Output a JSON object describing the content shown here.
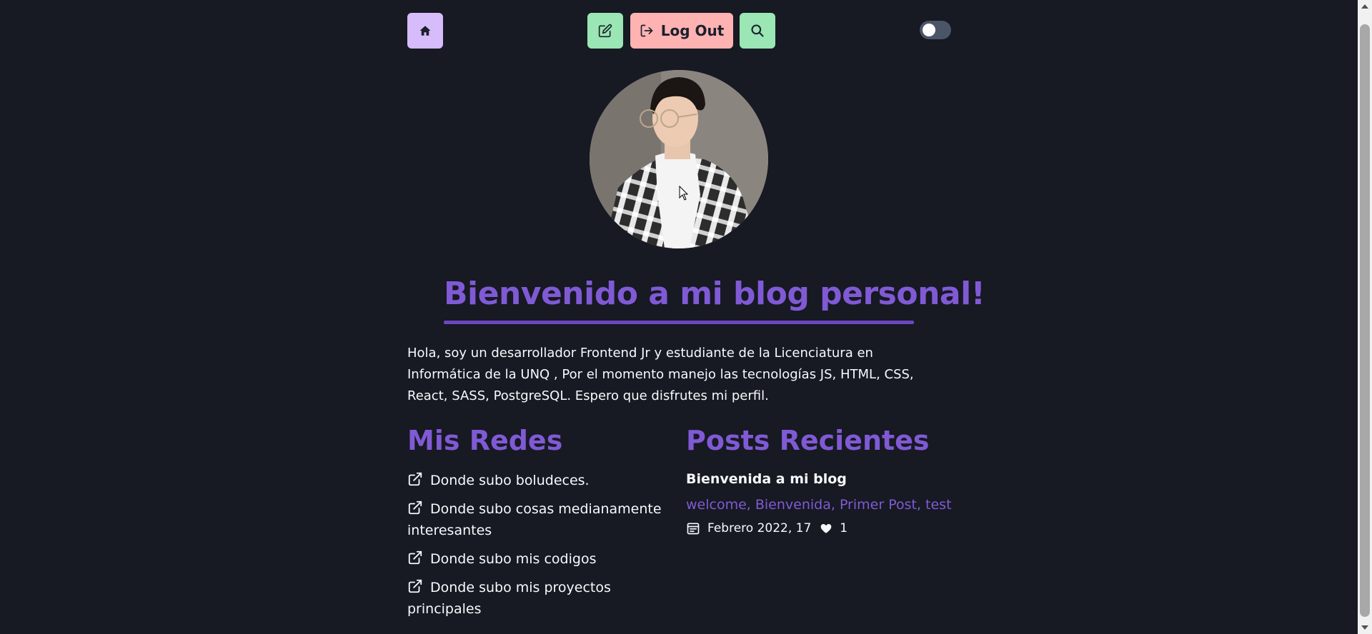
{
  "navbar": {
    "home_icon": "home-icon",
    "edit_icon": "edit-icon",
    "logout_label": "Log Out",
    "logout_icon": "logout-icon",
    "search_icon": "search-icon",
    "theme_toggle_state": "off"
  },
  "colors": {
    "background": "#171923",
    "accent_purple": "#805ad5",
    "home_button": "#d6bcfa",
    "green_button": "#9ae6b4",
    "logout_button": "#feb2b2"
  },
  "hero": {
    "title": "Bienvenido a mi blog personal!",
    "intro": "Hola, soy un desarrollador Frontend Jr y estudiante de la Licenciatura en Informática de la UNQ , Por el momento manejo las tecnologías JS, HTML, CSS, React, SASS, PostgreSQL. Espero que disfrutes mi perfil."
  },
  "redes": {
    "title": "Mis Redes",
    "links": [
      {
        "label": "Donde subo boludeces."
      },
      {
        "label": "Donde subo cosas medianamente interesantes"
      },
      {
        "label": "Donde subo mis codigos"
      },
      {
        "label": "Donde subo mis proyectos principales"
      }
    ]
  },
  "posts": {
    "title": "Posts Recientes",
    "items": [
      {
        "title": "Bienvenida a mi blog",
        "tags": "welcome, Bienvenida, Primer Post, test",
        "date": "Febrero 2022, 17",
        "likes": "1"
      }
    ]
  }
}
